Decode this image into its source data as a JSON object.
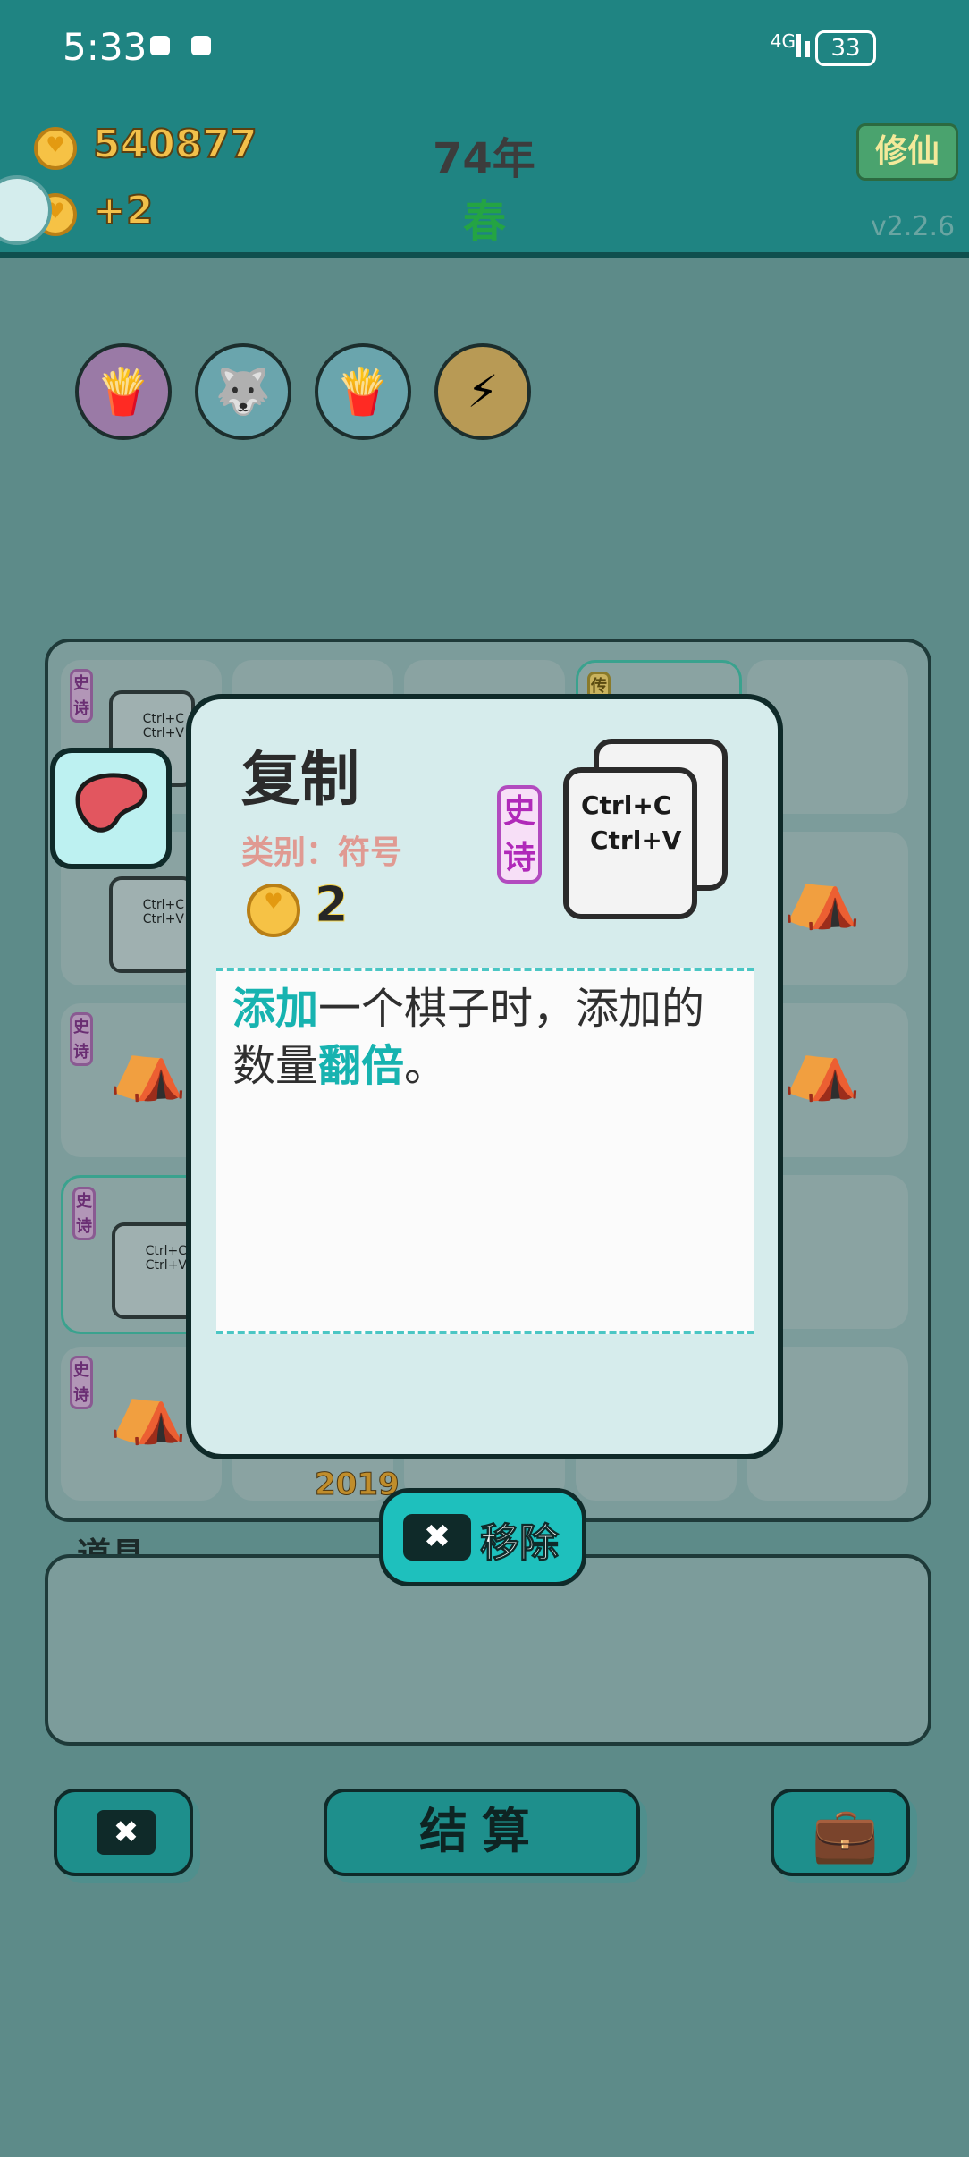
{
  "status_bar": {
    "time": "5:33",
    "network": "4G",
    "battery": "33"
  },
  "header": {
    "coins": "540877",
    "income": "+2",
    "year": "74年",
    "season": "春",
    "mode_button": "修仙",
    "version": "v2.2.6"
  },
  "relics": [
    {
      "icon": "fries-icon"
    },
    {
      "icon": "husky-dog-icon"
    },
    {
      "icon": "fries-icon"
    },
    {
      "icon": "lightning-icon"
    }
  ],
  "board": {
    "year_label": "2019",
    "tag_epic": "史诗",
    "tag_legend": "传",
    "mini_card": {
      "line1": "Ctrl+C",
      "line2": "Ctrl+V"
    }
  },
  "popup": {
    "title": "复制",
    "category": "类别：符号",
    "price": "2",
    "rarity": "史诗",
    "card_line1": "Ctrl+C",
    "card_line2": "Ctrl+V",
    "desc_hl1": "添加",
    "desc_1": "一个棋子时，添加的数量",
    "desc_hl2": "翻倍",
    "desc_2": "。"
  },
  "remove_button": "移除",
  "items_label": "道具",
  "settle_button": "结算",
  "colors": {
    "teal": "#1ec0bd",
    "header": "#1f8482",
    "overlay_bg": "#5d8b89"
  }
}
